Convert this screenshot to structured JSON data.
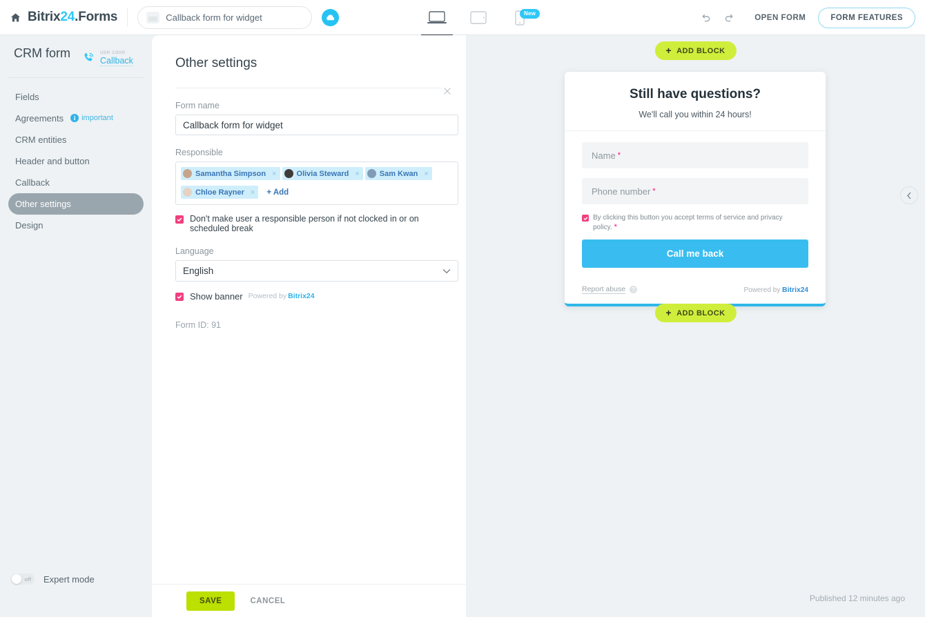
{
  "topbar": {
    "home_icon": "home-icon",
    "brand_prefix": "Bitrix",
    "brand_number": "24",
    "brand_suffix": ".Forms",
    "form_name_value": "Callback form for widget",
    "form_name_placeholder": "Form name",
    "cloud_icon": "cloud-icon",
    "devices": [
      {
        "name": "desktop",
        "icon": "laptop-icon",
        "active": true,
        "badge": ""
      },
      {
        "name": "tablet",
        "icon": "tablet-icon",
        "active": false,
        "badge": ""
      },
      {
        "name": "mobile",
        "icon": "mobile-icon",
        "active": false,
        "badge": "New"
      }
    ],
    "undo_icon": "undo-icon",
    "redo_icon": "redo-icon",
    "open_form_label": "OPEN FORM",
    "form_features_label": "FORM FEATURES"
  },
  "sidebar": {
    "title": "CRM form",
    "usecase_label": "use case",
    "usecase_value": "Callback",
    "phone_icon": "phone-call-icon",
    "items": [
      {
        "label": "Fields",
        "active": false,
        "badge": ""
      },
      {
        "label": "Agreements",
        "active": false,
        "badge": "important"
      },
      {
        "label": "CRM entities",
        "active": false,
        "badge": ""
      },
      {
        "label": "Header and button",
        "active": false,
        "badge": ""
      },
      {
        "label": "Callback",
        "active": false,
        "badge": ""
      },
      {
        "label": "Other settings",
        "active": true,
        "badge": ""
      },
      {
        "label": "Design",
        "active": false,
        "badge": ""
      }
    ],
    "expert_mode_label": "Expert mode",
    "expert_mode_state": "off"
  },
  "panel": {
    "title": "Other settings",
    "close_icon": "close-icon",
    "form_name_label": "Form name",
    "form_name_value": "Callback form for widget",
    "responsible_label": "Responsible",
    "responsible": [
      {
        "name": "Samantha Simpson",
        "avatar_color": "#c6a48c"
      },
      {
        "name": "Olivia Steward",
        "avatar_color": "#3f3b38"
      },
      {
        "name": "Sam Kwan",
        "avatar_color": "#7f9bb5"
      },
      {
        "name": "Chloe Rayner",
        "avatar_color": "#e5d2c4"
      }
    ],
    "add_label": "+ Add",
    "remove_icon": "close-small-icon",
    "clocked_in_checkbox_label": "Don't make user a responsible person if not clocked in or on scheduled break",
    "clocked_in_checked": true,
    "language_label": "Language",
    "language_value": "English",
    "language_options": [
      "English"
    ],
    "show_banner_label": "Show banner",
    "show_banner_checked": true,
    "powered_by_text": "Powered by",
    "powered_by_brand": "Bitrix24",
    "form_id_text": "Form ID: 91"
  },
  "bottombar": {
    "save_label": "SAVE",
    "cancel_label": "CANCEL"
  },
  "preview": {
    "add_block_top_label": "ADD BLOCK",
    "add_block_bottom_label": "ADD BLOCK",
    "form": {
      "title": "Still have questions?",
      "subtitle": "We'll call you within 24 hours!",
      "fields": [
        {
          "placeholder": "Name",
          "required": true
        },
        {
          "placeholder": "Phone number",
          "required": true
        }
      ],
      "consent_text": "By clicking this button you accept terms of service and privacy policy.",
      "consent_checked": true,
      "consent_required": true,
      "submit_label": "Call me back",
      "report_abuse_label": "Report abuse",
      "help_icon": "question-mark-icon",
      "powered_by_text": "Powered by",
      "powered_by_brand": "Bitrix",
      "powered_by_number": "24"
    },
    "collapse_icon": "chevron-left-icon",
    "published_status": "Published 12 minutes ago"
  },
  "colors": {
    "brand_blue": "#2fc7f7",
    "accent_green": "#cfed3b",
    "save_green": "#bce000",
    "checkbox_pink": "#f0407f",
    "submit_blue": "#39bdf0",
    "chip_blue": "#cfeefc"
  }
}
